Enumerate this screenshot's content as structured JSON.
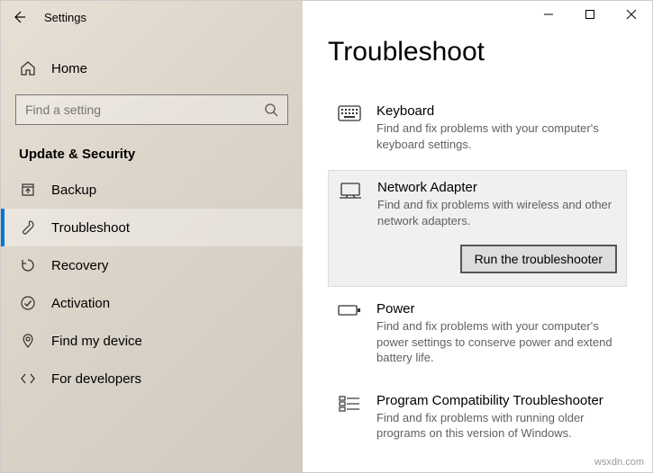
{
  "app": {
    "title": "Settings"
  },
  "nav": {
    "home": "Home",
    "search_placeholder": "Find a setting",
    "section": "Update & Security",
    "items": [
      {
        "label": "Backup"
      },
      {
        "label": "Troubleshoot"
      },
      {
        "label": "Recovery"
      },
      {
        "label": "Activation"
      },
      {
        "label": "Find my device"
      },
      {
        "label": "For developers"
      }
    ]
  },
  "main": {
    "title": "Troubleshoot",
    "items": [
      {
        "title": "Keyboard",
        "desc": "Find and fix problems with your computer's keyboard settings."
      },
      {
        "title": "Network Adapter",
        "desc": "Find and fix problems with wireless and other network adapters.",
        "run_label": "Run the troubleshooter"
      },
      {
        "title": "Power",
        "desc": "Find and fix problems with your computer's power settings to conserve power and extend battery life."
      },
      {
        "title": "Program Compatibility Troubleshooter",
        "desc": "Find and fix problems with running older programs on this version of Windows."
      }
    ]
  },
  "watermark": "wsxdn.com"
}
